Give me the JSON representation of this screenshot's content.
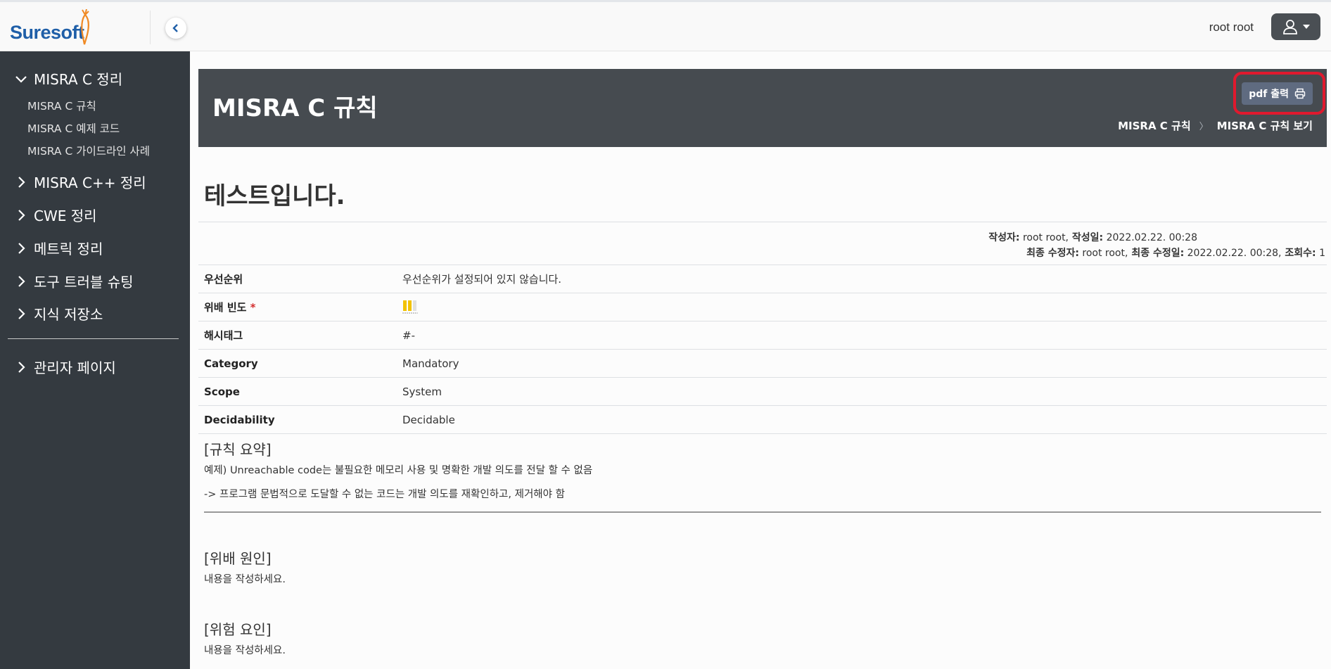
{
  "header": {
    "logo_text": "Suresoft",
    "user_name": "root root"
  },
  "sidebar": {
    "groups": [
      {
        "label": "MISRA C 정리",
        "expanded": true,
        "items": [
          "MISRA C 규칙",
          "MISRA C 예제 코드",
          "MISRA C 가이드라인 사례"
        ]
      },
      {
        "label": "MISRA C++ 정리",
        "expanded": false
      },
      {
        "label": "CWE 정리",
        "expanded": false
      },
      {
        "label": "메트릭 정리",
        "expanded": false
      },
      {
        "label": "도구 트러블 슈팅",
        "expanded": false
      },
      {
        "label": "지식 저장소",
        "expanded": false
      },
      {
        "label": "관리자 페이지",
        "expanded": false
      }
    ]
  },
  "banner": {
    "title": "MISRA C 규칙",
    "pdf_button": "pdf 출력",
    "breadcrumb": [
      "MISRA C 규칙",
      "MISRA C 규칙 보기"
    ]
  },
  "doc": {
    "title": "테스트입니다.",
    "meta": {
      "author_label": "작성자:",
      "author": " root root,",
      "created_label": " 작성일:",
      "created": " 2022.02.22. 00:28",
      "modifier_label": "최종 수정자:",
      "modifier": " root root,",
      "modified_label": " 최종 수정일:",
      "modified": " 2022.02.22. 00:28,",
      "views_label": " 조회수:",
      "views": " 1"
    },
    "fields": [
      {
        "label": "우선순위",
        "value": "우선순위가 설정되어 있지 않습니다."
      },
      {
        "label": "위배 빈도",
        "required_mark": "*",
        "value": ""
      },
      {
        "label": "해시태그",
        "value": "#-"
      },
      {
        "label": "Category",
        "value": "Mandatory"
      },
      {
        "label": "Scope",
        "value": "System"
      },
      {
        "label": "Decidability",
        "value": "Decidable"
      }
    ],
    "frequency_level": 2,
    "frequency_max": 3,
    "sections": [
      {
        "heading": "[규칙 요약]",
        "lines": [
          "예제) Unreachable code는 불필요한 메모리 사용 및 명확한 개발 의도를 전달 할 수 없음",
          "-> 프로그램 문법적으로 도달할 수 없는 코드는 개발 의도를 재확인하고, 제거해야 함"
        ]
      },
      {
        "heading": "[위배 원인]",
        "lines": [
          "내용을 작성하세요."
        ]
      },
      {
        "heading": "[위험 요인]",
        "lines": [
          "내용을 작성하세요."
        ]
      }
    ]
  },
  "colors": {
    "sidebar_bg": "#343a40",
    "banner_bg": "#464b50",
    "pdf_button_bg": "#5f6b80",
    "highlight": "#e0192e",
    "frequency_bar": "#f2c200"
  }
}
